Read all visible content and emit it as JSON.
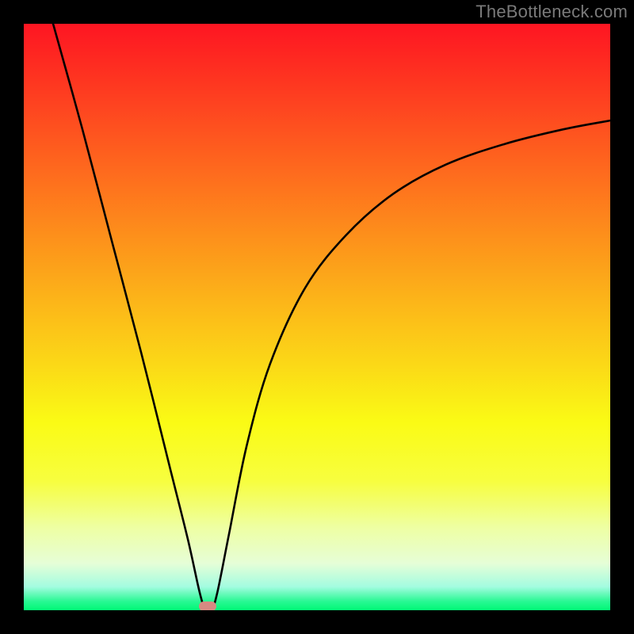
{
  "attribution": "TheBottleneck.com",
  "chart_data": {
    "type": "line",
    "title": "",
    "xlabel": "",
    "ylabel": "",
    "xlim": [
      0,
      100
    ],
    "ylim": [
      0,
      100
    ],
    "grid": false,
    "series": [
      {
        "name": "curve",
        "x": [
          5,
          10,
          15,
          20,
          25,
          28,
          30,
          31,
          32,
          33,
          35,
          38,
          42,
          48,
          55,
          63,
          72,
          82,
          92,
          100
        ],
        "y": [
          100,
          82,
          63,
          44,
          24,
          12,
          3,
          0,
          0,
          3,
          13,
          28,
          42,
          55,
          64,
          71,
          76,
          79.5,
          82,
          83.5
        ]
      }
    ],
    "marker": {
      "x": 31.3,
      "y": 0.7
    },
    "background_gradient_stops": [
      {
        "pct": 0,
        "color": "#fe1522"
      },
      {
        "pct": 12,
        "color": "#fe3d20"
      },
      {
        "pct": 24,
        "color": "#fe661e"
      },
      {
        "pct": 36,
        "color": "#fd8f1b"
      },
      {
        "pct": 47,
        "color": "#fcb419"
      },
      {
        "pct": 58,
        "color": "#fbd817"
      },
      {
        "pct": 68,
        "color": "#fafb15"
      },
      {
        "pct": 78,
        "color": "#f7fe3f"
      },
      {
        "pct": 86,
        "color": "#eeffa4"
      },
      {
        "pct": 92,
        "color": "#e6fed7"
      },
      {
        "pct": 96,
        "color": "#a3fce0"
      },
      {
        "pct": 98.5,
        "color": "#28f893"
      },
      {
        "pct": 100,
        "color": "#00f876"
      }
    ]
  }
}
